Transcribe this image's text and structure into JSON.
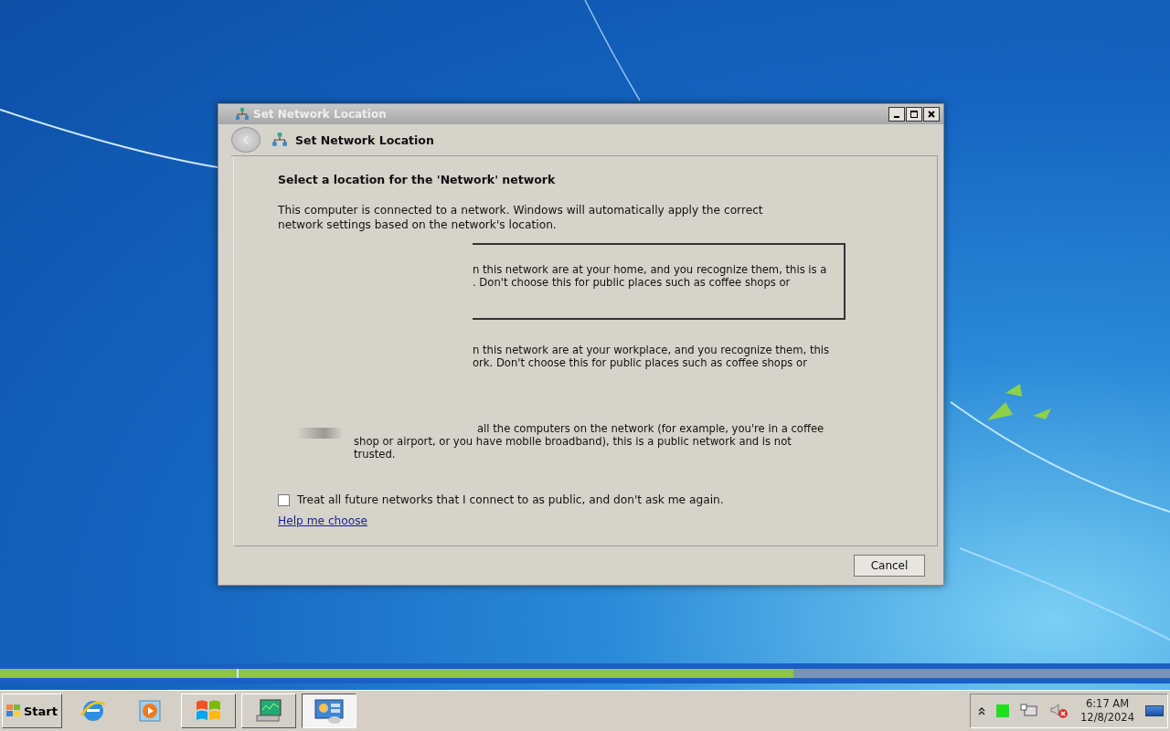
{
  "window": {
    "title": "Set Network Location"
  },
  "header": {
    "title": "Set Network Location"
  },
  "heading": "Select a location for the 'Network' network",
  "intro": "This computer is connected to a network. Windows will automatically apply the correct network settings based on the network's location.",
  "options": [
    {
      "kind": "home",
      "selected": true,
      "lines": [
        "n this network are at your home, and you recognize them, this is a",
        ".  Don't choose this for public places such as coffee shops or"
      ]
    },
    {
      "kind": "work",
      "selected": false,
      "lines": [
        "n this network are at your workplace, and you recognize them, this",
        "ork.  Don't choose this for public places such as coffee shops or"
      ]
    },
    {
      "kind": "public",
      "selected": false,
      "lines": [
        "all the computers on the network (for example, you're in a coffee",
        "shop or airport, or you have mobile broadband), this is a public network and is not",
        "trusted."
      ]
    }
  ],
  "checkbox": {
    "label": "Treat all future networks that I connect to as public, and don't ask me again.",
    "checked": false
  },
  "link": "Help me choose",
  "buttons": [
    "Cancel"
  ],
  "progress": {
    "level": 0.678
  },
  "taskbar": {
    "start": "Start",
    "time": "6:17 AM",
    "date": "12/8/2024"
  }
}
